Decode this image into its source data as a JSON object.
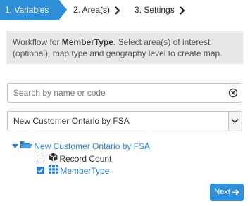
{
  "steps": [
    {
      "label": "1. Variables",
      "active": true
    },
    {
      "label": "2. Area(s)",
      "active": false
    },
    {
      "label": "3. Settings",
      "active": false
    }
  ],
  "info": {
    "prefix": "Workflow for ",
    "bold": "MemberType",
    "suffix": ". Select area(s) of interest (optional), map type and geography level to create map."
  },
  "search": {
    "value": "",
    "placeholder": "Search by name or code",
    "clear_icon": "clear-circle-icon"
  },
  "dataset_select": {
    "selected": "New Customer Ontario by FSA"
  },
  "tree": {
    "root": {
      "label": "New Customer Ontario by FSA",
      "icon": "folder-open-icon",
      "expanded": true
    },
    "items": [
      {
        "label": "Record Count",
        "icon": "cube-icon",
        "checked": false
      },
      {
        "label": "MemberType",
        "icon": "grid-icon",
        "checked": true
      }
    ]
  },
  "next_button": {
    "label": "Next"
  },
  "colors": {
    "accent": "#2f8fd8",
    "link": "#2a7fd0",
    "info_bg": "#e6e7e8"
  }
}
